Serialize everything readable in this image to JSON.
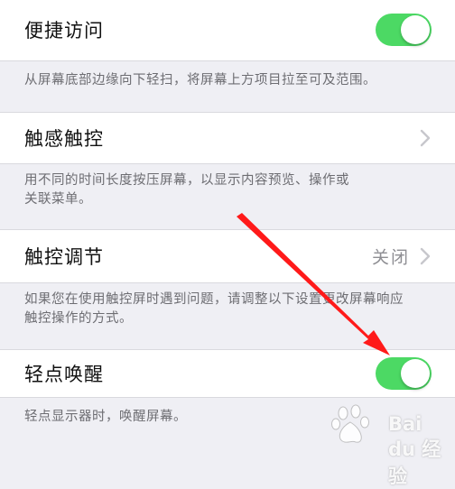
{
  "settings": [
    {
      "label": "便捷访问",
      "control": "toggle",
      "on": true,
      "description": "从屏幕底部边缘向下轻扫，将屏幕上方项目拉至可及范围。"
    },
    {
      "label": "触感触控",
      "control": "chevron",
      "description_lines": [
        "用不同的时间长度按压屏幕，以显示内容预览、操作或",
        "关联菜单。"
      ]
    },
    {
      "label": "触控调节",
      "control": "chevron",
      "value": "关闭",
      "description_lines": [
        "如果您在使用触控屏时遇到问题，请调整以下设置更改屏幕响应",
        "触控操作的方式。"
      ]
    },
    {
      "label": "轻点唤醒",
      "control": "toggle",
      "on": true,
      "description": "轻点显示器时，唤醒屏幕。"
    }
  ],
  "watermark": {
    "text": "Bai du 经验"
  },
  "colors": {
    "toggle_on": "#4cd964",
    "background": "#efeff4",
    "arrow": "#ff1a1a"
  },
  "icons": [
    "chevron-right-icon",
    "red-arrow-icon",
    "baidu-paw-icon"
  ]
}
